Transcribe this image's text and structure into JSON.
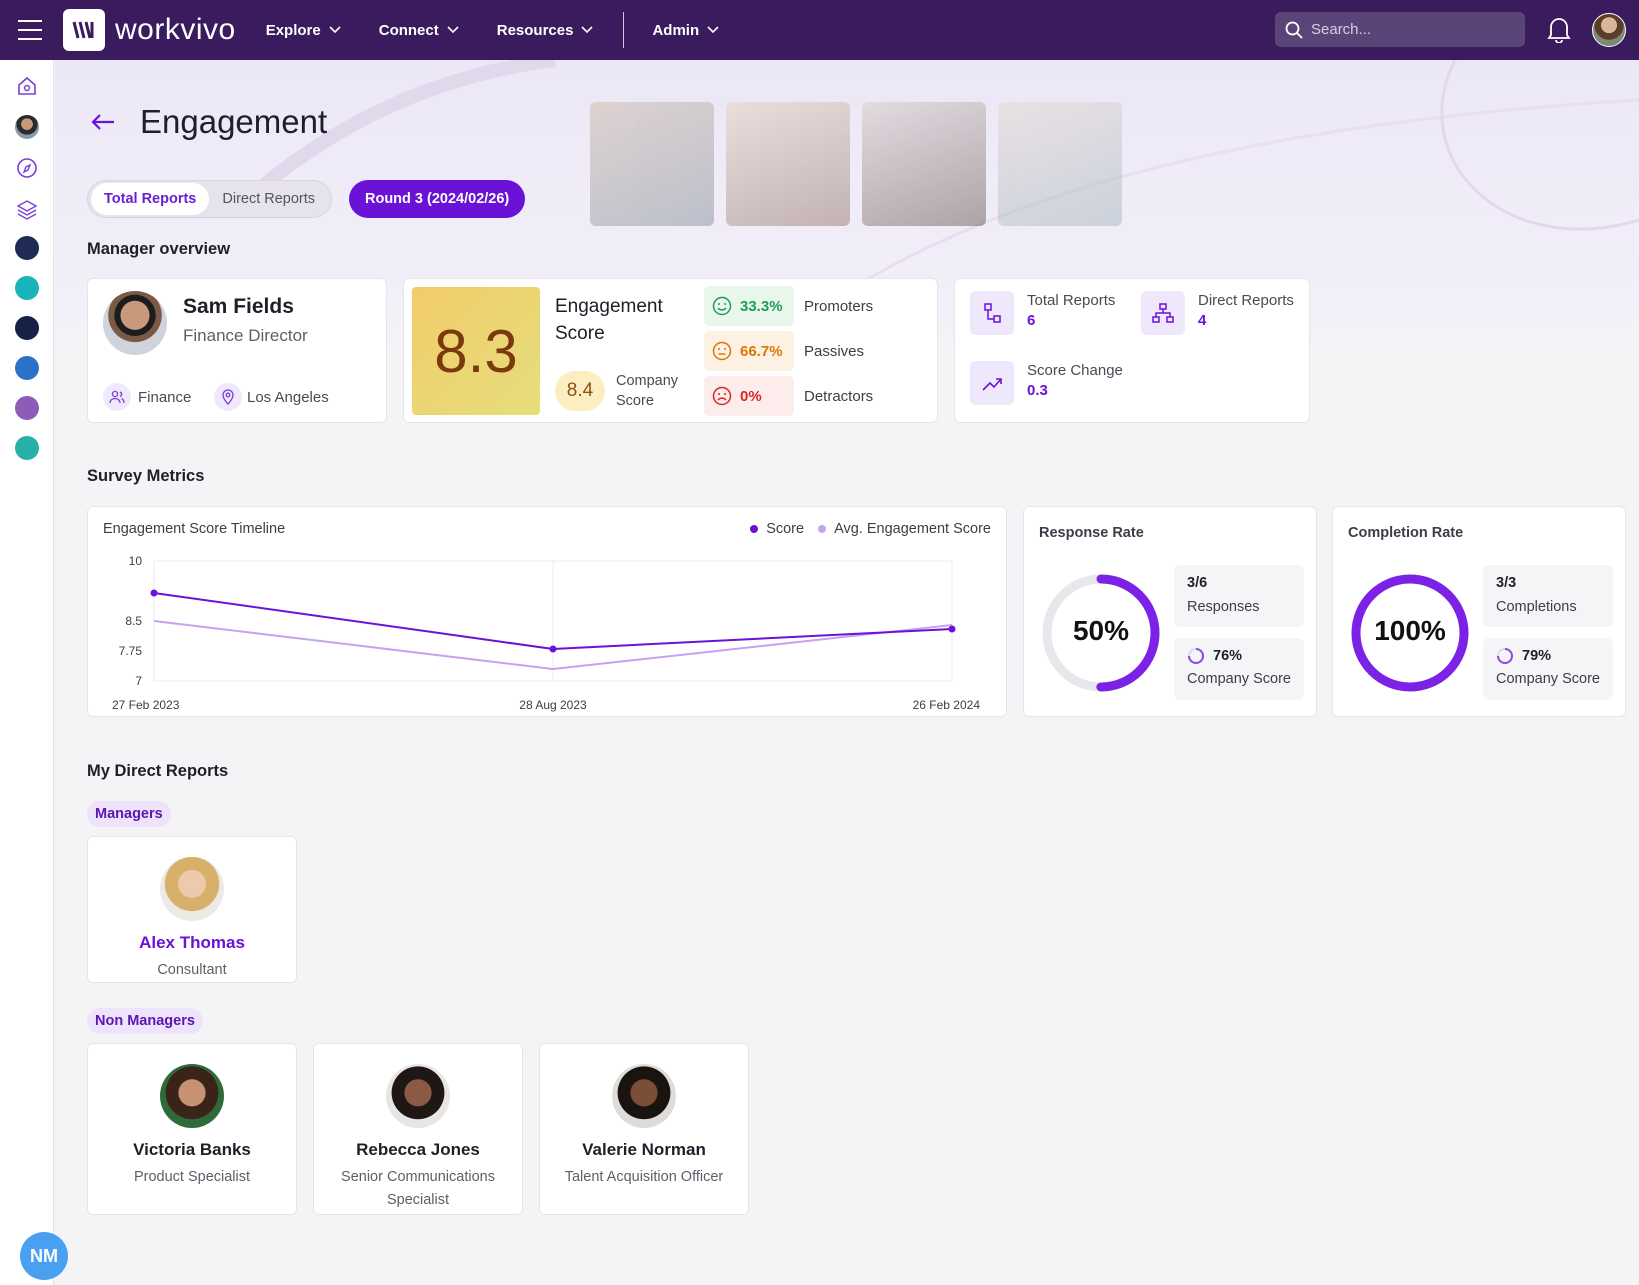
{
  "app": {
    "brand": "workvivo"
  },
  "topbar": {
    "nav": [
      {
        "label": "Explore"
      },
      {
        "label": "Connect"
      },
      {
        "label": "Resources"
      },
      {
        "label": "Admin"
      }
    ],
    "search_placeholder": "Search..."
  },
  "page": {
    "title": "Engagement",
    "tabs": [
      {
        "label": "Total Reports",
        "active": true
      },
      {
        "label": "Direct Reports",
        "active": false
      }
    ],
    "round_button": "Round 3 (2024/02/26)"
  },
  "manager_overview": {
    "section_title": "Manager overview",
    "name": "Sam Fields",
    "role": "Finance Director",
    "department": "Finance",
    "location": "Los Angeles",
    "engagement_score": "8.3",
    "engagement_label": "Engagement Score",
    "company_score": "8.4",
    "company_score_label": "Company Score",
    "breakdown": [
      {
        "value": "33.3%",
        "label": "Promoters",
        "color": "#1f9d55"
      },
      {
        "value": "66.7%",
        "label": "Passives",
        "color": "#d97706"
      },
      {
        "value": "0%",
        "label": "Detractors",
        "color": "#dc2626"
      }
    ],
    "totals": {
      "total_reports_label": "Total Reports",
      "total_reports": "6",
      "direct_reports_label": "Direct Reports",
      "direct_reports": "4",
      "score_change_label": "Score Change",
      "score_change": "0.3"
    }
  },
  "survey_metrics": {
    "section_title": "Survey Metrics",
    "response_rate": {
      "title": "Response Rate",
      "percent_label": "50%",
      "percent": 0.5,
      "count": "3/6",
      "count_label": "Responses",
      "company_percent": "76%",
      "company_label": "Company Score"
    },
    "completion_rate": {
      "title": "Completion Rate",
      "percent_label": "100%",
      "percent": 1.0,
      "count": "3/3",
      "count_label": "Completions",
      "company_percent": "79%",
      "company_label": "Company Score"
    }
  },
  "chart_data": {
    "type": "line",
    "title": "Engagement Score Timeline",
    "categories": [
      "27 Feb 2023",
      "28 Aug 2023",
      "26 Feb 2024"
    ],
    "series": [
      {
        "name": "Score",
        "values": [
          9.2,
          7.8,
          8.3
        ],
        "color": "#6a12d6"
      },
      {
        "name": "Avg. Engagement Score",
        "values": [
          8.5,
          7.3,
          8.4
        ],
        "color": "#c6a3f0"
      }
    ],
    "yticks": [
      "10",
      "8.5",
      "7.75",
      "7"
    ],
    "ylim": [
      7,
      10
    ],
    "grid": true,
    "legend": "top-right"
  },
  "direct_reports": {
    "section_title": "My Direct Reports",
    "managers_tag": "Managers",
    "managers": [
      {
        "name": "Alex Thomas",
        "role": "Consultant"
      }
    ],
    "non_managers_tag": "Non Managers",
    "non_managers": [
      {
        "name": "Victoria Banks",
        "role": "Product Specialist"
      },
      {
        "name": "Rebecca Jones",
        "role": "Senior Communications Specialist"
      },
      {
        "name": "Valerie Norman",
        "role": "Talent Acquisition Officer"
      }
    ]
  },
  "user": {
    "initials": "NM"
  }
}
